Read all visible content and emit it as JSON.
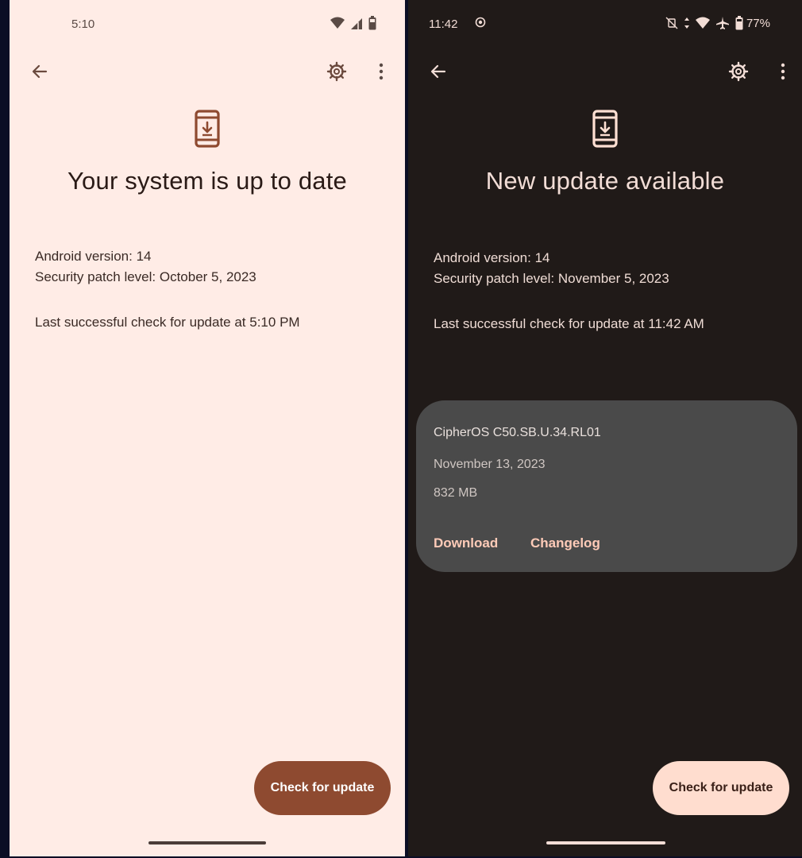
{
  "colors": {
    "light_background": "#ffece6",
    "dark_background": "#201a18",
    "light_accent": "#8e4a30",
    "dark_fab": "#ffddcf",
    "dark_card": "#4a4a4a",
    "dark_link": "#ffcbb8"
  },
  "light": {
    "status": {
      "time": "5:10",
      "icons": [
        "wifi-icon",
        "signal-icon",
        "battery-icon"
      ]
    },
    "headline": "Your system is up to date",
    "android_version": "Android version: 14",
    "security_patch": "Security patch level: October 5, 2023",
    "last_check": "Last successful check for update at 5:10 PM",
    "fab_label": "Check for update"
  },
  "dark": {
    "status": {
      "time": "11:42",
      "icons": [
        "record-icon",
        "vibrate-off-icon",
        "data-arrows-icon",
        "wifi-icon",
        "airplane-icon",
        "battery-icon"
      ],
      "battery_percent": "77%"
    },
    "headline": "New update available",
    "android_version": "Android version: 14",
    "security_patch": "Security patch level: November 5, 2023",
    "last_check": "Last successful check for update at 11:42 AM",
    "update_card": {
      "version": "CipherOS C50.SB.U.34.RL01",
      "date": "November 13, 2023",
      "size": "832 MB",
      "download_label": "Download",
      "changelog_label": "Changelog"
    },
    "fab_label": "Check for update"
  }
}
